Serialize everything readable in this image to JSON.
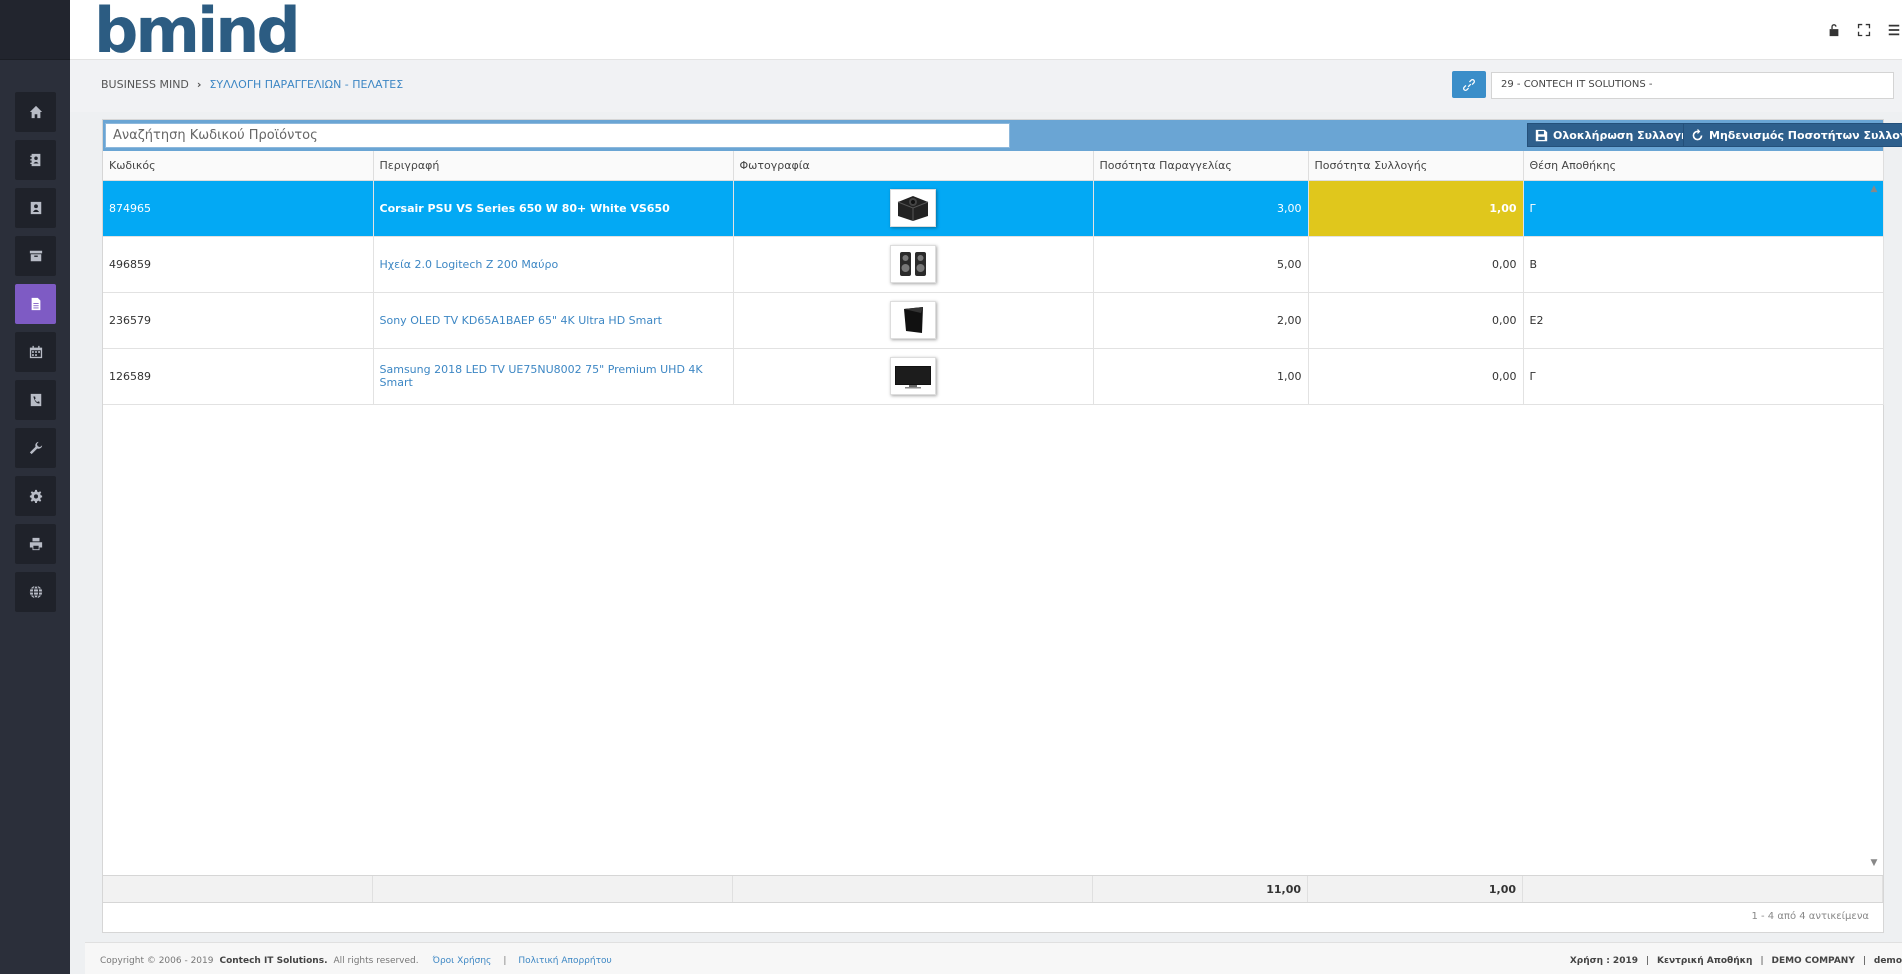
{
  "app": {
    "logo_main": "bmind",
    "brand_color": "#2c5c82",
    "accent_color": "#7e5bc4"
  },
  "sidebar": {
    "items": [
      {
        "icon": "home-icon",
        "active": false
      },
      {
        "icon": "address-book-icon",
        "active": false
      },
      {
        "icon": "contact-card-icon",
        "active": false
      },
      {
        "icon": "archive-icon",
        "active": false
      },
      {
        "icon": "document-icon",
        "active": true
      },
      {
        "icon": "calendar-icon",
        "active": false
      },
      {
        "icon": "phone-icon",
        "active": false
      },
      {
        "icon": "wrench-icon",
        "active": false
      },
      {
        "icon": "gear-icon",
        "active": false
      },
      {
        "icon": "printer-icon",
        "active": false
      },
      {
        "icon": "globe-icon",
        "active": false
      }
    ]
  },
  "breadcrumb": {
    "root": "BUSINESS MIND",
    "current": "ΣΥΛΛΟΓΗ ΠΑΡΑΓΓΕΛΙΩΝ - ΠΕΛΑΤΕΣ"
  },
  "company_select": {
    "value": "29 - CONTECH IT SOLUTIONS -"
  },
  "toolbar": {
    "search_placeholder": "Αναζήτηση Κωδικού Προϊόντος",
    "complete_label": "Ολοκλήρωση Συλλογής",
    "reset_label": "Μηδενισμός Ποσοτήτων Συλλογής"
  },
  "table": {
    "columns": [
      "Κωδικός",
      "Περιγραφή",
      "Φωτογραφία",
      "Ποσότητα Παραγγελίας",
      "Ποσότητα Συλλογής",
      "Θέση Αποθήκης"
    ],
    "rows": [
      {
        "code": "874965",
        "desc": "Corsair PSU VS Series 650 W 80+ White VS650",
        "photo": "psu",
        "ordered": "3,00",
        "picked": "1,00",
        "location": "Γ"
      },
      {
        "code": "496859",
        "desc": "Ηχεία 2.0 Logitech Z 200 Μαύρο",
        "photo": "speakers",
        "ordered": "5,00",
        "picked": "0,00",
        "location": "Β"
      },
      {
        "code": "236579",
        "desc": "Sony OLED TV KD65A1BAEP 65\" 4K Ultra HD Smart",
        "photo": "oled-tv",
        "ordered": "2,00",
        "picked": "0,00",
        "location": "Ε2"
      },
      {
        "code": "126589",
        "desc": "Samsung 2018 LED TV UE75NU8002 75\" Premium UHD 4K Smart",
        "photo": "led-tv",
        "ordered": "1,00",
        "picked": "0,00",
        "location": "Γ"
      }
    ],
    "totals": {
      "ordered": "11,00",
      "picked": "1,00"
    },
    "pager_info": "1 - 4 από 4 αντικείμενα"
  },
  "footer": {
    "copyright_prefix": "Copyright © 2006 - 2019",
    "company": "Contech IT Solutions.",
    "rights": "All rights reserved.",
    "terms": "Όροι Χρήσης",
    "privacy": "Πολιτική Απορρήτου",
    "sep": "|",
    "year": "Χρήση : 2019",
    "warehouse": "Κεντρική Αποθήκη",
    "company_name": "DEMO COMPANY",
    "user": "demo"
  }
}
